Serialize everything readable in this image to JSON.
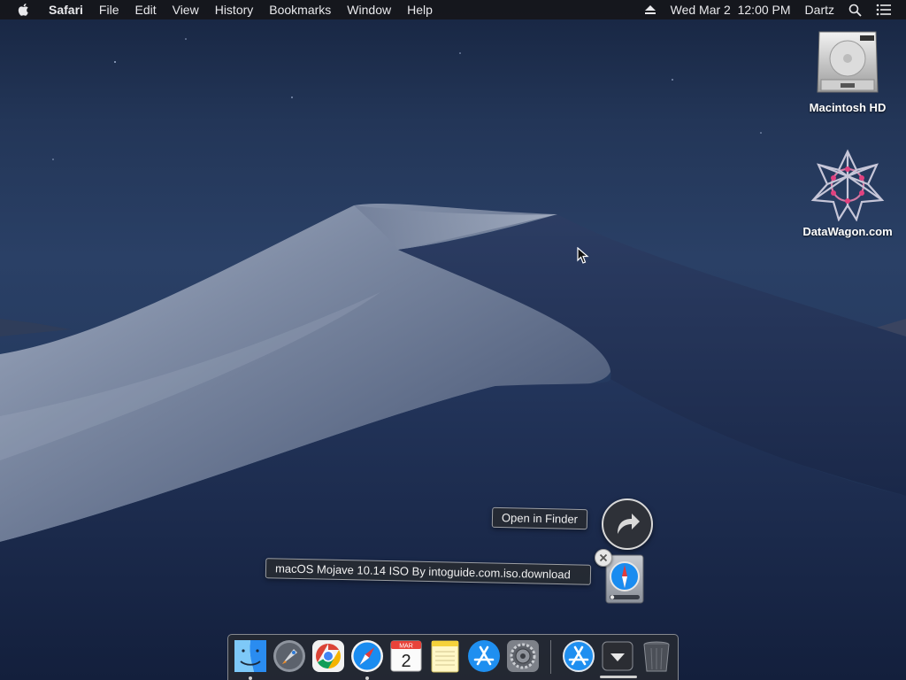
{
  "menubar": {
    "apple_icon": "apple-logo-icon",
    "app_name": "Safari",
    "items": [
      "File",
      "Edit",
      "View",
      "History",
      "Bookmarks",
      "Window",
      "Help"
    ],
    "clock": "Wed Mar 2  12:00 PM",
    "user": "Dartz",
    "eject_icon": "eject-icon",
    "search_icon": "spotlight-search-icon",
    "notification_icon": "notification-center-icon"
  },
  "desktop": {
    "wallpaper": "macOS Mojave dunes at night",
    "icons": [
      {
        "label": "Macintosh HD",
        "icon": "hard-drive-icon"
      },
      {
        "label": "DataWagon.com",
        "icon": "datawagon-logo-icon"
      }
    ]
  },
  "download": {
    "open_in_finder_label": "Open in Finder",
    "file_name": "macOS Mojave 10.14 ISO By intoguide.com.iso.download",
    "reveal_icon": "reveal-arrow-icon",
    "close_icon": "close-icon",
    "file_icon": "safari-download-file-icon"
  },
  "dock": {
    "apps": [
      {
        "name": "Finder",
        "icon": "finder-icon",
        "running": true
      },
      {
        "name": "Launchpad",
        "icon": "launchpad-icon",
        "running": false
      },
      {
        "name": "Google Chrome",
        "icon": "chrome-icon",
        "running": false
      },
      {
        "name": "Safari",
        "icon": "safari-icon",
        "running": true
      },
      {
        "name": "Calendar",
        "icon": "calendar-icon",
        "running": false,
        "month": "MAR",
        "day": "2"
      },
      {
        "name": "Notes",
        "icon": "notes-icon",
        "running": false
      },
      {
        "name": "App Store",
        "icon": "app-store-icon",
        "running": false
      },
      {
        "name": "System Preferences",
        "icon": "system-preferences-icon",
        "running": false
      }
    ],
    "others": [
      {
        "name": "App Store Downloads",
        "icon": "app-store-icon"
      },
      {
        "name": "Downloads",
        "icon": "downloads-stack-icon"
      },
      {
        "name": "Trash",
        "icon": "trash-icon"
      }
    ]
  },
  "colors": {
    "sky": "#233658",
    "dune_light": "#8c97ad",
    "dune_dark": "#1d2c4f",
    "menubar": "#16161a",
    "safari_blue": "#1a8cf0"
  }
}
